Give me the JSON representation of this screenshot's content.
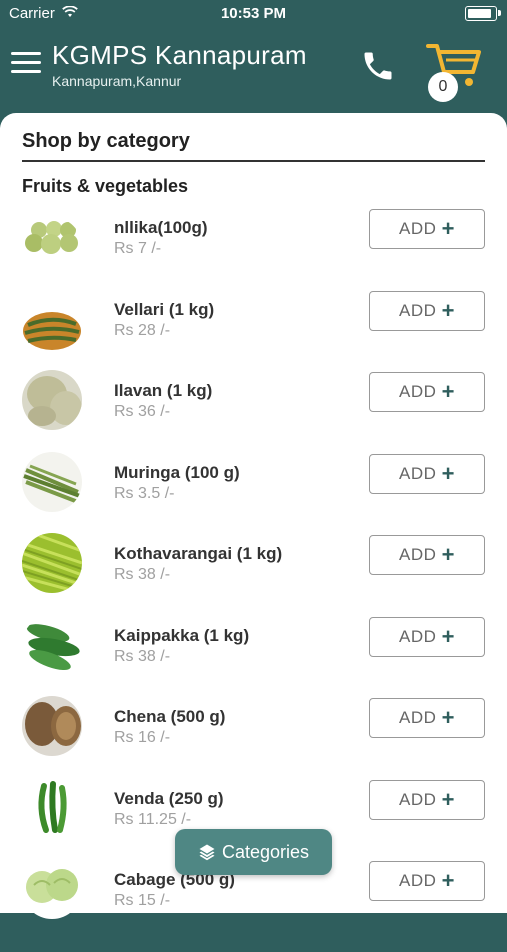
{
  "status_bar": {
    "carrier": "Carrier",
    "time": "10:53 PM"
  },
  "header": {
    "title": "KGMPS Kannapuram",
    "subtitle": "Kannapuram,Kannur",
    "cart_count": "0"
  },
  "main": {
    "section_title": "Shop by category",
    "category_title": "Fruits & vegetables",
    "add_label": "ADD",
    "items": [
      {
        "name": "nllika(100g)",
        "price": "Rs 7 /-"
      },
      {
        "name": "Vellari (1 kg)",
        "price": "Rs 28 /-"
      },
      {
        "name": "Ilavan (1 kg)",
        "price": "Rs 36 /-"
      },
      {
        "name": "Muringa (100 g)",
        "price": "Rs 3.5 /-"
      },
      {
        "name": "Kothavarangai (1 kg)",
        "price": "Rs 38 /-"
      },
      {
        "name": "Kaippakka (1 kg)",
        "price": "Rs 38 /-"
      },
      {
        "name": "Chena (500 g)",
        "price": "Rs 16 /-"
      },
      {
        "name": "Venda (250 g)",
        "price": "Rs 11.25 /-"
      },
      {
        "name": "Cabage (500 g)",
        "price": "Rs 15 /-"
      }
    ]
  },
  "floating": {
    "categories_label": "Categories"
  },
  "colors": {
    "header_bg": "#2f5e5d",
    "accent": "#4f8784",
    "cart": "#f2b632"
  }
}
